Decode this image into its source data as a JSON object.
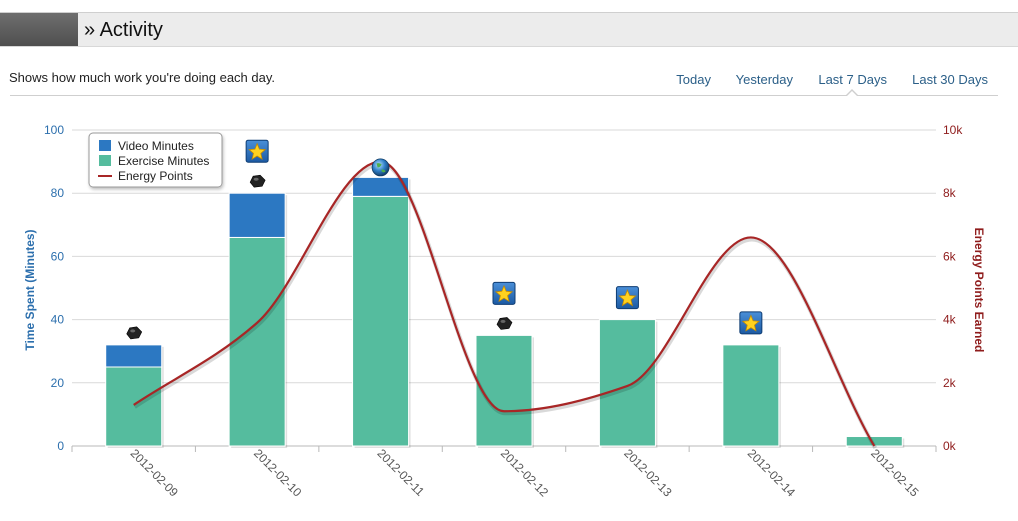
{
  "header": {
    "title": "» Activity"
  },
  "description": "Shows how much work you're doing each day.",
  "ranges": [
    {
      "label": "Today",
      "selected": false
    },
    {
      "label": "Yesterday",
      "selected": false
    },
    {
      "label": "Last 7 Days",
      "selected": true
    },
    {
      "label": "Last 30 Days",
      "selected": false
    }
  ],
  "colors": {
    "video": "#2c78c2",
    "exercise": "#55bc9e",
    "energy": "#a82626",
    "left_axis": "#2c6fad",
    "right_axis": "#8f1c1c"
  },
  "chart_data": {
    "type": "bar",
    "categories": [
      "2012-02-09",
      "2012-02-10",
      "2012-02-11",
      "2012-02-12",
      "2012-02-13",
      "2012-02-14",
      "2012-02-15"
    ],
    "series": [
      {
        "name": "Video Minutes",
        "type": "bar",
        "stack": "time",
        "axis": "left",
        "values": [
          7,
          14,
          6,
          0,
          0,
          0,
          0
        ]
      },
      {
        "name": "Exercise Minutes",
        "type": "bar",
        "stack": "time",
        "axis": "left",
        "values": [
          25,
          66,
          79,
          35,
          40,
          32,
          3
        ]
      },
      {
        "name": "Energy Points",
        "type": "line",
        "axis": "right",
        "values": [
          1300,
          3900,
          9000,
          1100,
          1900,
          6600,
          0
        ]
      }
    ],
    "yAxisLeft": {
      "label": "Time Spent (Minutes)",
      "ticks": [
        "0",
        "20",
        "40",
        "60",
        "80",
        "100"
      ],
      "range": [
        0,
        100
      ]
    },
    "yAxisRight": {
      "label": "Energy Points Earned",
      "ticks": [
        "0k",
        "2k",
        "4k",
        "6k",
        "8k",
        "10k"
      ],
      "range": [
        0,
        10000
      ]
    },
    "legend": {
      "position": "top-left",
      "entries": [
        "Video Minutes",
        "Exercise Minutes",
        "Energy Points"
      ]
    },
    "grid": true,
    "badges": [
      {
        "category": "2012-02-09",
        "icons": [
          "meteorite-badge-icon"
        ]
      },
      {
        "category": "2012-02-10",
        "icons": [
          "star-badge-icon",
          "meteorite-badge-icon"
        ]
      },
      {
        "category": "2012-02-11",
        "icons": [
          "earth-badge-icon"
        ]
      },
      {
        "category": "2012-02-12",
        "icons": [
          "star-badge-icon",
          "meteorite-badge-icon"
        ]
      },
      {
        "category": "2012-02-13",
        "icons": [
          "star-badge-icon"
        ]
      },
      {
        "category": "2012-02-14",
        "icons": [
          "star-badge-icon"
        ]
      }
    ]
  }
}
